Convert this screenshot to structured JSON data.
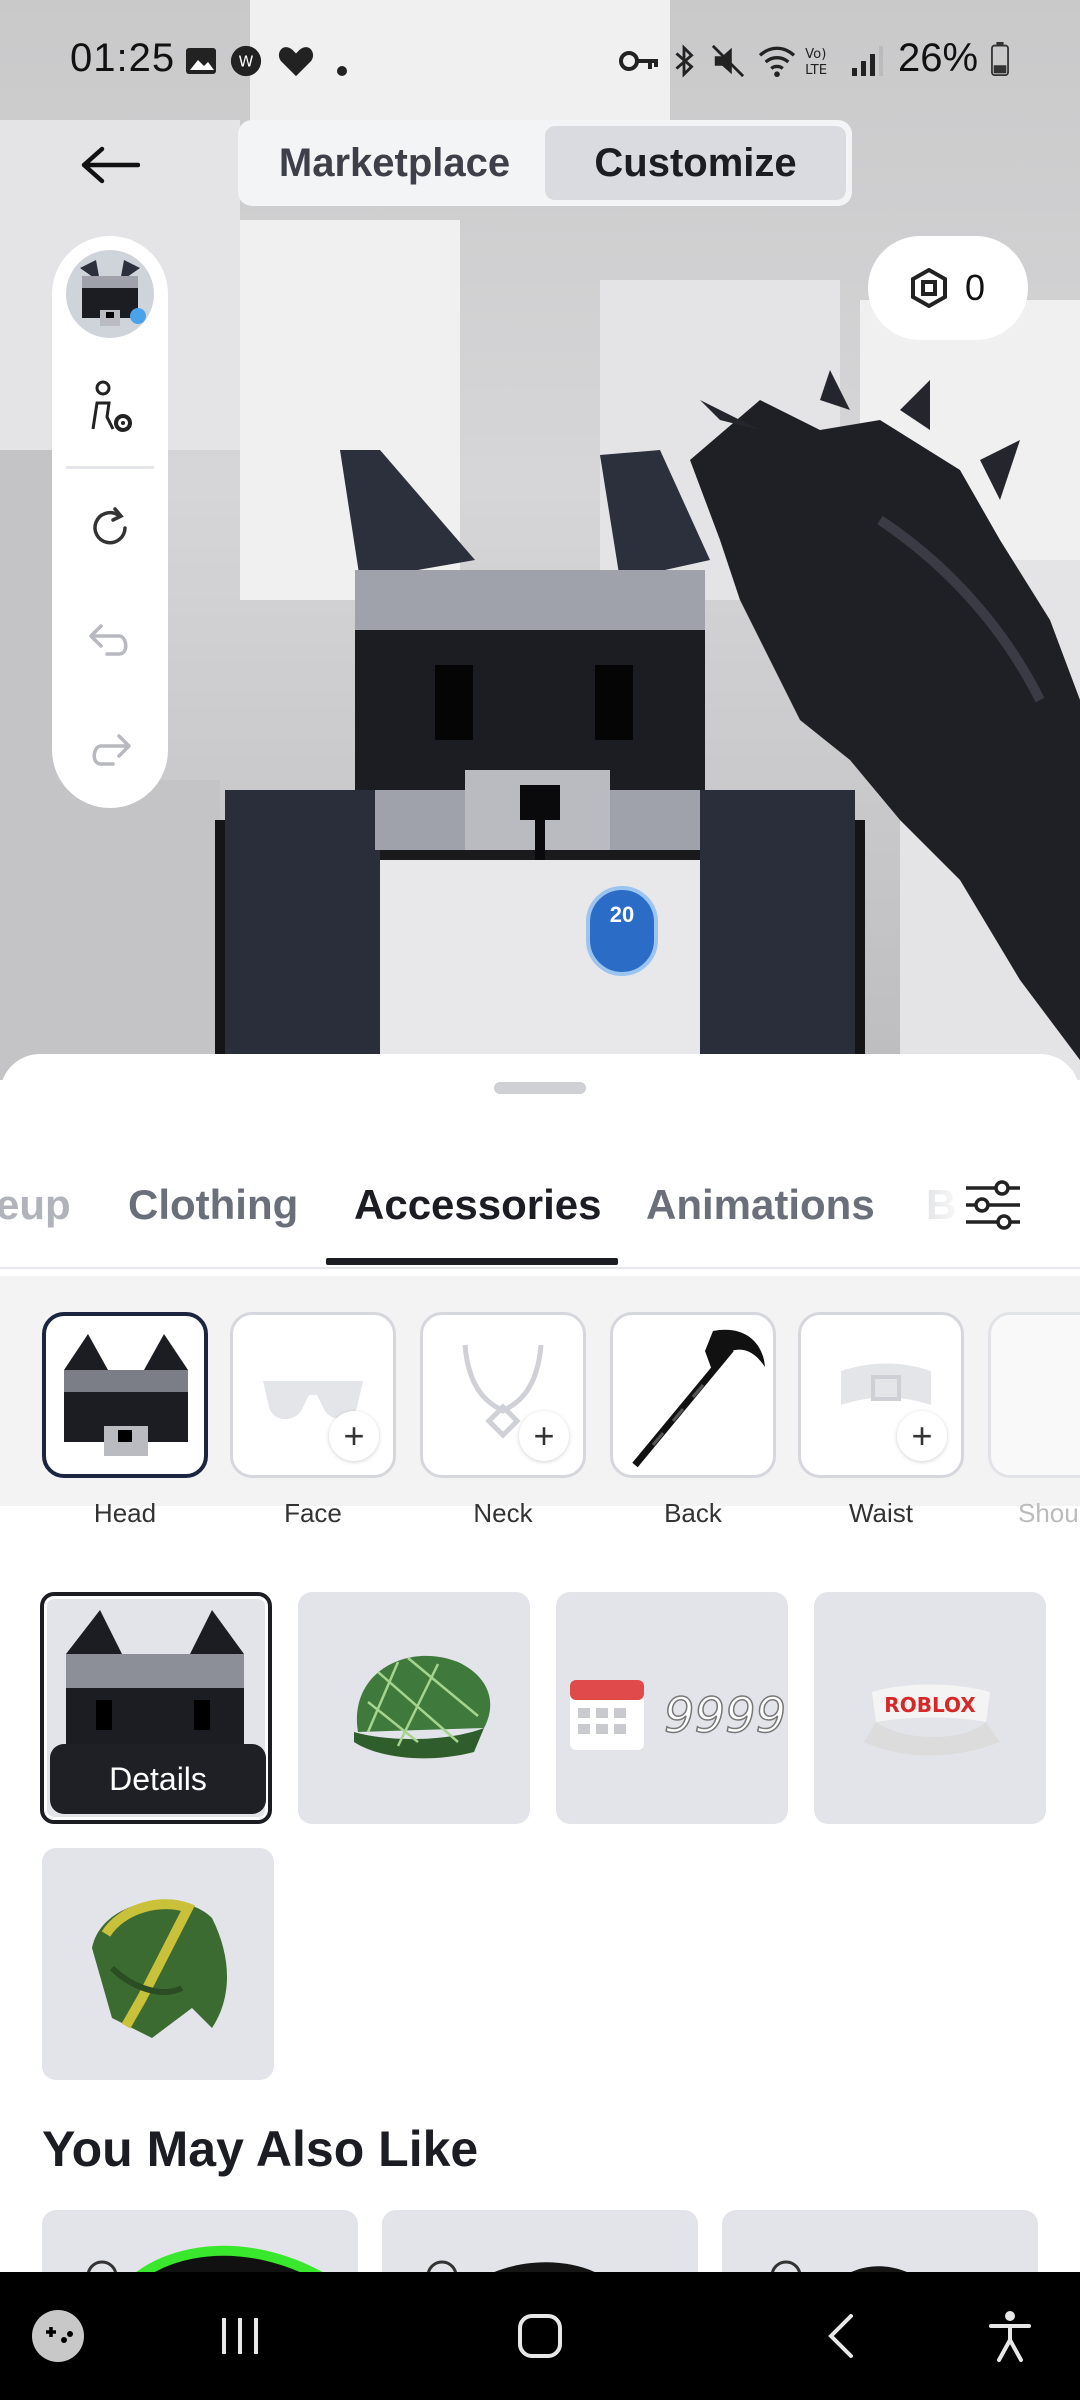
{
  "status_bar": {
    "time": "01:25",
    "battery_percent": "26%",
    "icons": [
      "gallery-icon",
      "app-icon",
      "health-icon",
      "dot-icon",
      "vpn-key-icon",
      "bluetooth-icon",
      "mute-icon",
      "wifi-icon",
      "volte-icon",
      "signal-icon",
      "battery-icon"
    ]
  },
  "header": {
    "back_icon": "arrow-left-icon",
    "tabs": [
      {
        "label": "Marketplace",
        "active": false
      },
      {
        "label": "Customize",
        "active": true
      }
    ],
    "robux_count": "0"
  },
  "tool_rail": {
    "items": [
      "avatar-thumbnail",
      "avatar-settings-icon",
      "rotate-icon",
      "undo-icon",
      "redo-icon"
    ]
  },
  "avatar_badge": {
    "count": "20"
  },
  "categories": {
    "tabs": [
      {
        "label": "eup",
        "active": false
      },
      {
        "label": "Clothing",
        "active": false
      },
      {
        "label": "Accessories",
        "active": true
      },
      {
        "label": "Animations",
        "active": false
      },
      {
        "label": "B",
        "active": false
      }
    ],
    "filter_icon": "sliders-icon"
  },
  "slots": [
    {
      "label": "Head",
      "selected": true,
      "empty": false,
      "icon": "wolf-head-icon"
    },
    {
      "label": "Face",
      "selected": false,
      "empty": true,
      "icon": "glasses-icon"
    },
    {
      "label": "Neck",
      "selected": false,
      "empty": true,
      "icon": "necklace-icon"
    },
    {
      "label": "Back",
      "selected": false,
      "empty": false,
      "icon": "scythe-icon"
    },
    {
      "label": "Waist",
      "selected": false,
      "empty": true,
      "icon": "belt-icon"
    },
    {
      "label": "Shou",
      "selected": false,
      "empty": true,
      "icon": "shoulder-icon"
    }
  ],
  "items": [
    {
      "name": "wolf-head-item",
      "selected": true,
      "details_label": "Details"
    },
    {
      "name": "green-plaid-cap-item",
      "selected": false
    },
    {
      "name": "calendar-9999-item",
      "selected": false,
      "text": "9999"
    },
    {
      "name": "roblox-visor-item",
      "selected": false,
      "text": "ROBLOX"
    },
    {
      "name": "green-hood-item",
      "selected": false
    }
  ],
  "recommendations": {
    "title": "You May Also Like"
  },
  "colors": {
    "accent_dark": "#1b1d22",
    "sheet_bg": "#ffffff",
    "tile_bg": "#e3e4ea",
    "segment_active": "#d9dbe1"
  }
}
